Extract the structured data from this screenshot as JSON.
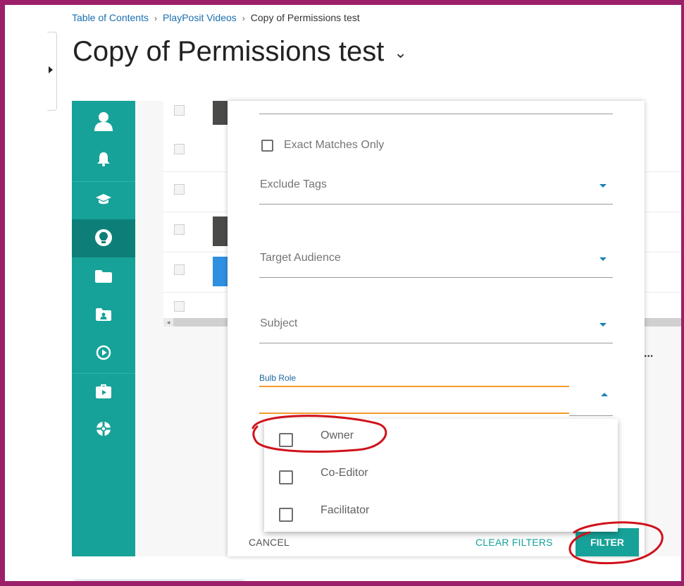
{
  "breadcrumb": {
    "items": [
      "Table of Contents",
      "PlayPosit Videos"
    ],
    "current": "Copy of Permissions test"
  },
  "page": {
    "title": "Copy of Permissions test"
  },
  "sidebar": {
    "items": [
      "user-icon",
      "bell-icon",
      "graduation-cap-icon",
      "lightbulb-icon",
      "folder-icon",
      "shared-folder-icon",
      "play-circle-icon",
      "briefcase-play-icon",
      "help-ring-icon"
    ],
    "active": "lightbulb-icon"
  },
  "filter_panel": {
    "exact_matches_label": "Exact Matches Only",
    "exclude_tags_label": "Exclude Tags",
    "target_audience_label": "Target Audience",
    "subject_label": "Subject",
    "bulb_role_label": "Bulb Role",
    "bulb_role_options": [
      "Owner",
      "Co-Editor",
      "Facilitator"
    ],
    "cancel_label": "CANCEL",
    "clear_filters_label": "CLEAR FILTERS",
    "filter_label": "FILTER"
  },
  "list": {
    "overflow_label": "..."
  },
  "colors": {
    "frame_border": "#9c1f6a",
    "sidebar": "#16a298",
    "sidebar_active": "#0d7f78",
    "accent_link": "#1a6fb0",
    "focus_underline": "#f39a2a",
    "annotation": "#d0121b"
  }
}
